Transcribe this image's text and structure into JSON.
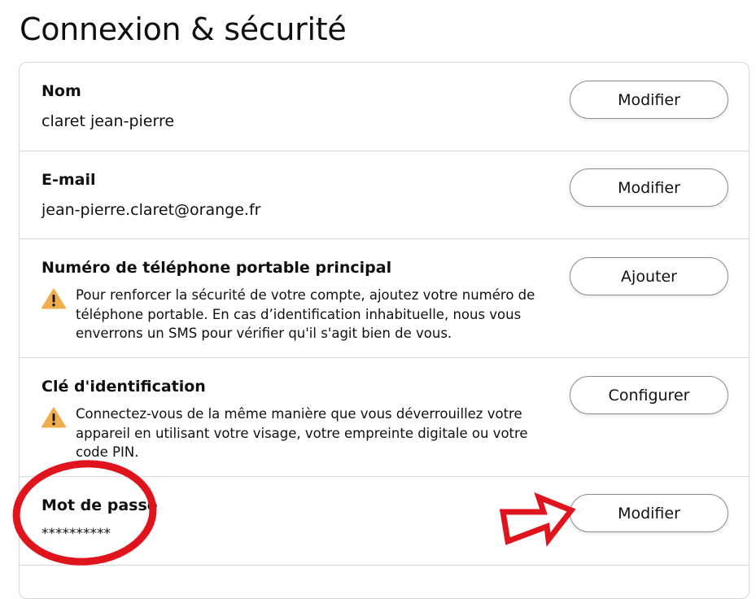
{
  "page": {
    "title": "Connexion & sécurité"
  },
  "rows": [
    {
      "label": "Nom",
      "value": "claret jean-pierre",
      "button": "Modifier"
    },
    {
      "label": "E-mail",
      "value": "jean-pierre.claret@orange.fr",
      "button": "Modifier"
    },
    {
      "label": "Numéro de téléphone portable principal",
      "note": "Pour renforcer la sécurité de votre compte, ajoutez votre numéro de téléphone portable. En cas d’identification inhabituelle, nous vous enverrons un SMS pour vérifier qu'il s'agit bien de vous.",
      "button": "Ajouter"
    },
    {
      "label": "Clé d'identification",
      "note": "Connectez-vous de la même manière que vous déverrouillez votre appareil en utilisant votre visage, votre empreinte digitale ou votre code PIN.",
      "button": "Configurer"
    },
    {
      "label": "Mot de passe",
      "value": "**********",
      "button": "Modifier"
    }
  ],
  "icons": {
    "warning": "warning-triangle-icon"
  },
  "colors": {
    "warning_fill": "#f0ad4e",
    "annotation": "#e0141c",
    "border": "#d5d9d9"
  }
}
